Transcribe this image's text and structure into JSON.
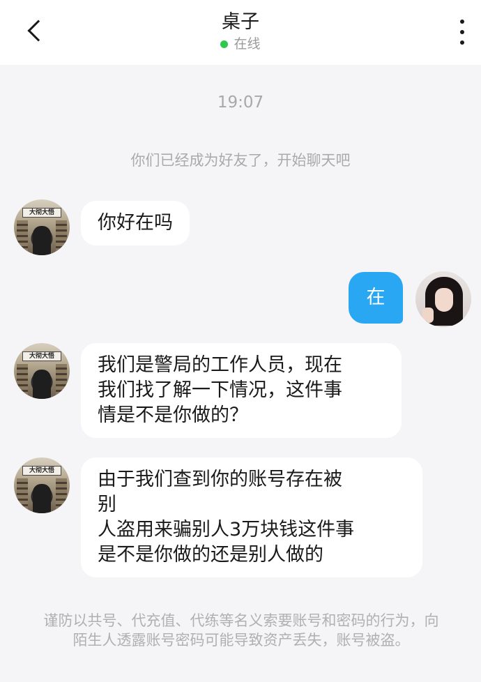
{
  "header": {
    "contact_name": "桌子",
    "status": "在线",
    "status_color": "#2dc84d",
    "back_icon": "chevron-left-icon",
    "more_icon": "more-vertical-icon"
  },
  "chat": {
    "timestamp": "19:07",
    "system_message": "你们已经成为好友了，开始聊天吧",
    "messages": [
      {
        "sender": "contact",
        "text": "你好在吗"
      },
      {
        "sender": "self",
        "text": "在"
      },
      {
        "sender": "contact",
        "text": "我们是警局的工作人员，现在\n我们找了解一下情况，这件事\n情是不是你做的？"
      },
      {
        "sender": "contact",
        "text": "由于我们查到你的账号存在被\n别\n人盗用来骗别人3万块钱这件事\n是不是你做的还是别人做的"
      }
    ],
    "contact_avatar_sign": "大彻大悟"
  },
  "footer": {
    "notice": "谨防以共号、代充值、代练等名义索要账号和密码的行为，向陌生人透露账号密码可能导致资产丢失，账号被盗。"
  },
  "colors": {
    "self_bubble": "#2aa7f3",
    "contact_bubble": "#ffffff",
    "background": "#f5f5f7"
  }
}
